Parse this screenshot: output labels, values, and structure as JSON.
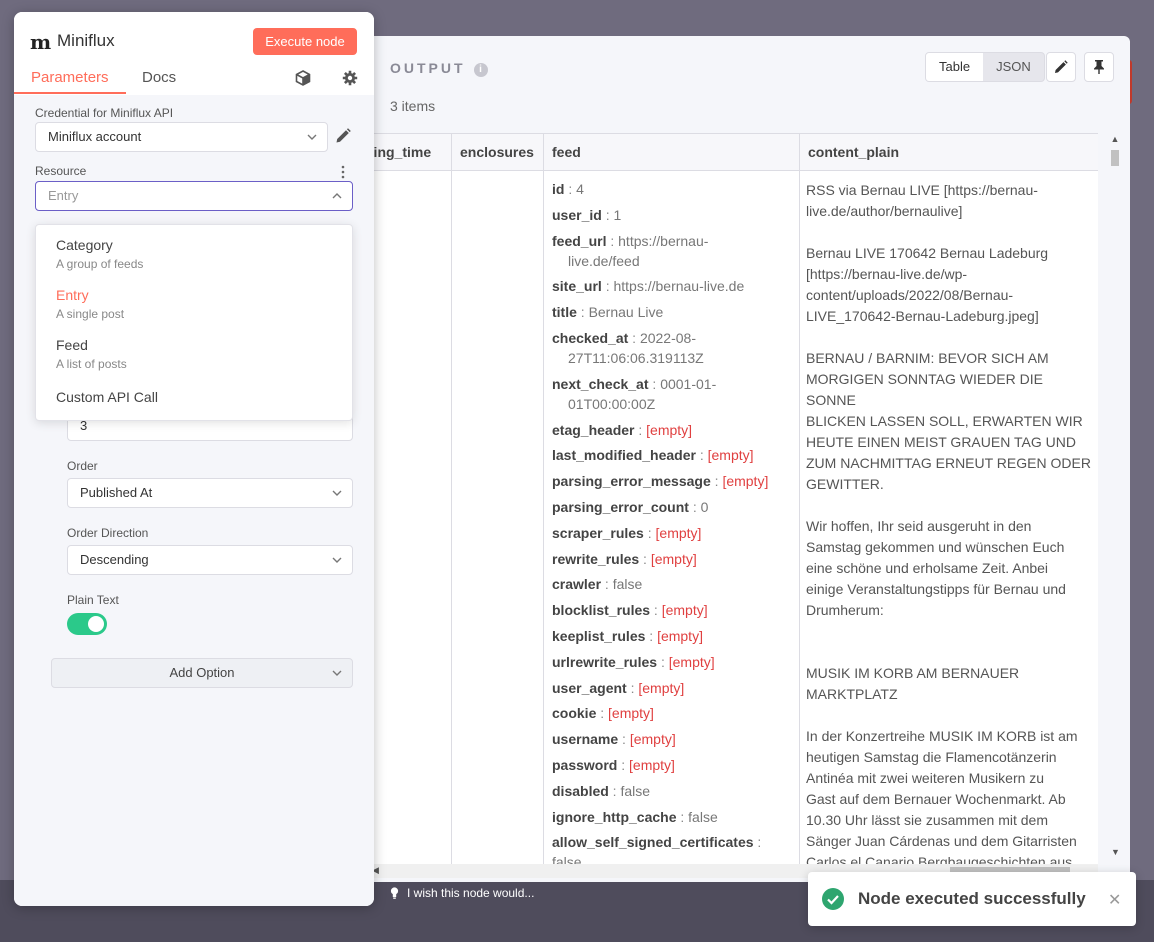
{
  "node": {
    "logo": "m",
    "title": "Miniflux",
    "execute_label": "Execute node",
    "tabs": {
      "parameters": "Parameters",
      "docs": "Docs"
    }
  },
  "params": {
    "credential_label": "Credential for Miniflux API",
    "credential_value": "Miniflux account",
    "resource_label": "Resource",
    "resource_placeholder": "Entry",
    "limit_value": "3",
    "order_label": "Order",
    "order_value": "Published At",
    "direction_label": "Order Direction",
    "direction_value": "Descending",
    "plain_text_label": "Plain Text",
    "add_option_label": "Add Option"
  },
  "resource_options": [
    {
      "title": "Category",
      "desc": "A group of feeds"
    },
    {
      "title": "Entry",
      "desc": "A single post"
    },
    {
      "title": "Feed",
      "desc": "A list of posts"
    },
    {
      "title": "Custom API Call",
      "desc": ""
    }
  ],
  "output": {
    "title": "OUTPUT",
    "info_icon": "i",
    "items_count": "3 items",
    "view_table": "Table",
    "view_json": "JSON",
    "columns": [
      "ding_time",
      "enclosures",
      "feed",
      "content_plain"
    ]
  },
  "feed_fields": [
    {
      "k": "id",
      "v": "4"
    },
    {
      "k": "user_id",
      "v": "1"
    },
    {
      "k": "feed_url",
      "v": "https://bernau-",
      "v2": "live.de/feed"
    },
    {
      "k": "site_url",
      "v": "https://bernau-live.de"
    },
    {
      "k": "title",
      "v": "Bernau Live"
    },
    {
      "k": "checked_at",
      "v": "2022-08-",
      "v2": "27T11:06:06.319113Z"
    },
    {
      "k": "next_check_at",
      "v": "0001-01-",
      "v2": "01T00:00:00Z"
    },
    {
      "k": "etag_header",
      "v": "[empty]",
      "empty": true
    },
    {
      "k": "last_modified_header",
      "v": "[empty]",
      "empty": true
    },
    {
      "k": "parsing_error_message",
      "v": "[empty]",
      "empty": true
    },
    {
      "k": "parsing_error_count",
      "v": "0"
    },
    {
      "k": "scraper_rules",
      "v": "[empty]",
      "empty": true
    },
    {
      "k": "rewrite_rules",
      "v": "[empty]",
      "empty": true
    },
    {
      "k": "crawler",
      "v": "false"
    },
    {
      "k": "blocklist_rules",
      "v": "[empty]",
      "empty": true
    },
    {
      "k": "keeplist_rules",
      "v": "[empty]",
      "empty": true
    },
    {
      "k": "urlrewrite_rules",
      "v": "[empty]",
      "empty": true
    },
    {
      "k": "user_agent",
      "v": "[empty]",
      "empty": true
    },
    {
      "k": "cookie",
      "v": "[empty]",
      "empty": true
    },
    {
      "k": "username",
      "v": "[empty]",
      "empty": true
    },
    {
      "k": "password",
      "v": "[empty]",
      "empty": true
    },
    {
      "k": "disabled",
      "v": "false"
    },
    {
      "k": "ignore_http_cache",
      "v": "false"
    },
    {
      "k": "allow_self_signed_certificates",
      "v": "false"
    }
  ],
  "content_plain": [
    "RSS via Bernau LIVE [https://bernau-\nlive.de/author/bernaulive]",
    "Bernau LIVE 170642 Bernau Ladeburg\n[https://bernau-live.de/wp-\ncontent/uploads/2022/08/Bernau-\nLIVE_170642-Bernau-Ladeburg.jpeg]",
    "BERNAU / BARNIM: BEVOR SICH AM\nMORGIGEN SONNTAG WIEDER DIE SONNE\nBLICKEN LASSEN SOLL, ERWARTEN WIR\nHEUTE EINEN MEIST GRAUEN TAG UND\nZUM NACHMITTAG ERNEUT REGEN ODER\nGEWITTER.",
    "Wir hoffen, Ihr seid ausgeruht in den\nSamstag gekommen und wünschen Euch\neine schöne und erholsame Zeit. Anbei\neinige Veranstaltungstipps für Bernau und\nDrumherum:\n ",
    "MUSIK IM KORB AM BERNAUER\nMARKTPLATZ",
    "In der Konzertreihe MUSIK IM KORB ist am\nheutigen Samstag die Flamencotänzerin\nAntinéa mit zwei weiteren Musikern zu\nGast auf dem Bernauer Wochenmarkt. Ab\n10.30 Uhr lässt sie zusammen mit dem\nSänger Juan Cárdenas und dem Gitarristen\nCarlos el Canario Bergbaugeschichten aus\nAndalusien und aus dem Ruhrgebiet"
  ],
  "footer": {
    "wish": "I wish this node would..."
  },
  "toast": {
    "message": "Node executed successfully",
    "close": "✕"
  },
  "colors": {
    "accent": "#ff6d5a",
    "success": "#2ea56f",
    "toggle_on": "#2bc98a",
    "empty_value": "#e04040"
  }
}
